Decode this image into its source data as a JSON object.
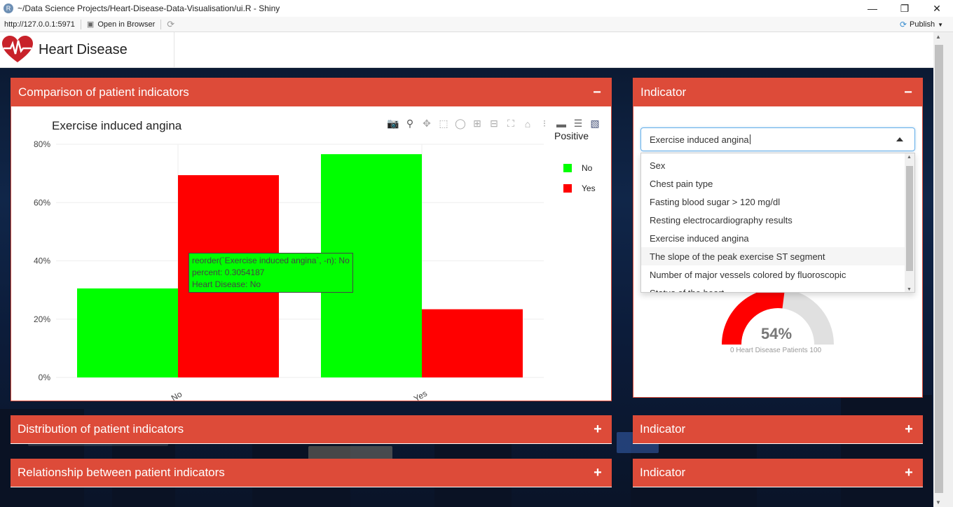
{
  "window": {
    "title": "~/Data Science Projects/Heart-Disease-Data-Visualisation/ui.R - Shiny",
    "url": "http://127.0.0.1:5971",
    "open_in_browser": "Open in Browser",
    "publish": "Publish"
  },
  "app": {
    "brand": "Heart Disease"
  },
  "comparison_box": {
    "title": "Comparison of patient indicators",
    "tool": "−",
    "plot_title": "Exercise induced angina",
    "legend_title": "Positive",
    "legend": [
      {
        "label": "No",
        "color": "#00ff00"
      },
      {
        "label": "Yes",
        "color": "#ff0000"
      }
    ],
    "tooltip": {
      "line1": "reorder(`Exercise induced angina`, -n): No",
      "line2": "percent: 0.3054187",
      "line3": "Heart Disease: No"
    }
  },
  "chart_data": {
    "type": "bar",
    "title": "Exercise induced angina",
    "categories": [
      "No",
      "Yes"
    ],
    "series": [
      {
        "name": "No",
        "color": "#00ff00",
        "values": [
          0.3054,
          0.766
        ]
      },
      {
        "name": "Yes",
        "color": "#ff0000",
        "values": [
          0.694,
          0.234
        ]
      }
    ],
    "ylim": [
      0,
      0.8
    ],
    "yticks": [
      "0%",
      "20%",
      "40%",
      "60%",
      "80%"
    ],
    "legend_title": "Positive"
  },
  "indicator_box": {
    "title": "Indicator",
    "tool": "−",
    "selected": "Exercise induced angina",
    "options": [
      "Sex",
      "Chest pain type",
      "Fasting blood sugar > 120 mg/dl",
      "Resting electrocardiography results",
      "Exercise induced angina",
      "The slope of the peak exercise ST segment",
      "Number of major vessels colored by fluoroscopic",
      "Status of the heart"
    ],
    "gauge_value": "54%",
    "gauge_level": 54,
    "gauge_label": "0   Heart Disease Patients 100"
  },
  "collapsed_boxes": [
    {
      "title": "Distribution of patient indicators",
      "tool": "+"
    },
    {
      "title": "Indicator",
      "tool": "+"
    },
    {
      "title": "Relationship between patient indicators",
      "tool": "+"
    },
    {
      "title": "Indicator",
      "tool": "+"
    }
  ]
}
